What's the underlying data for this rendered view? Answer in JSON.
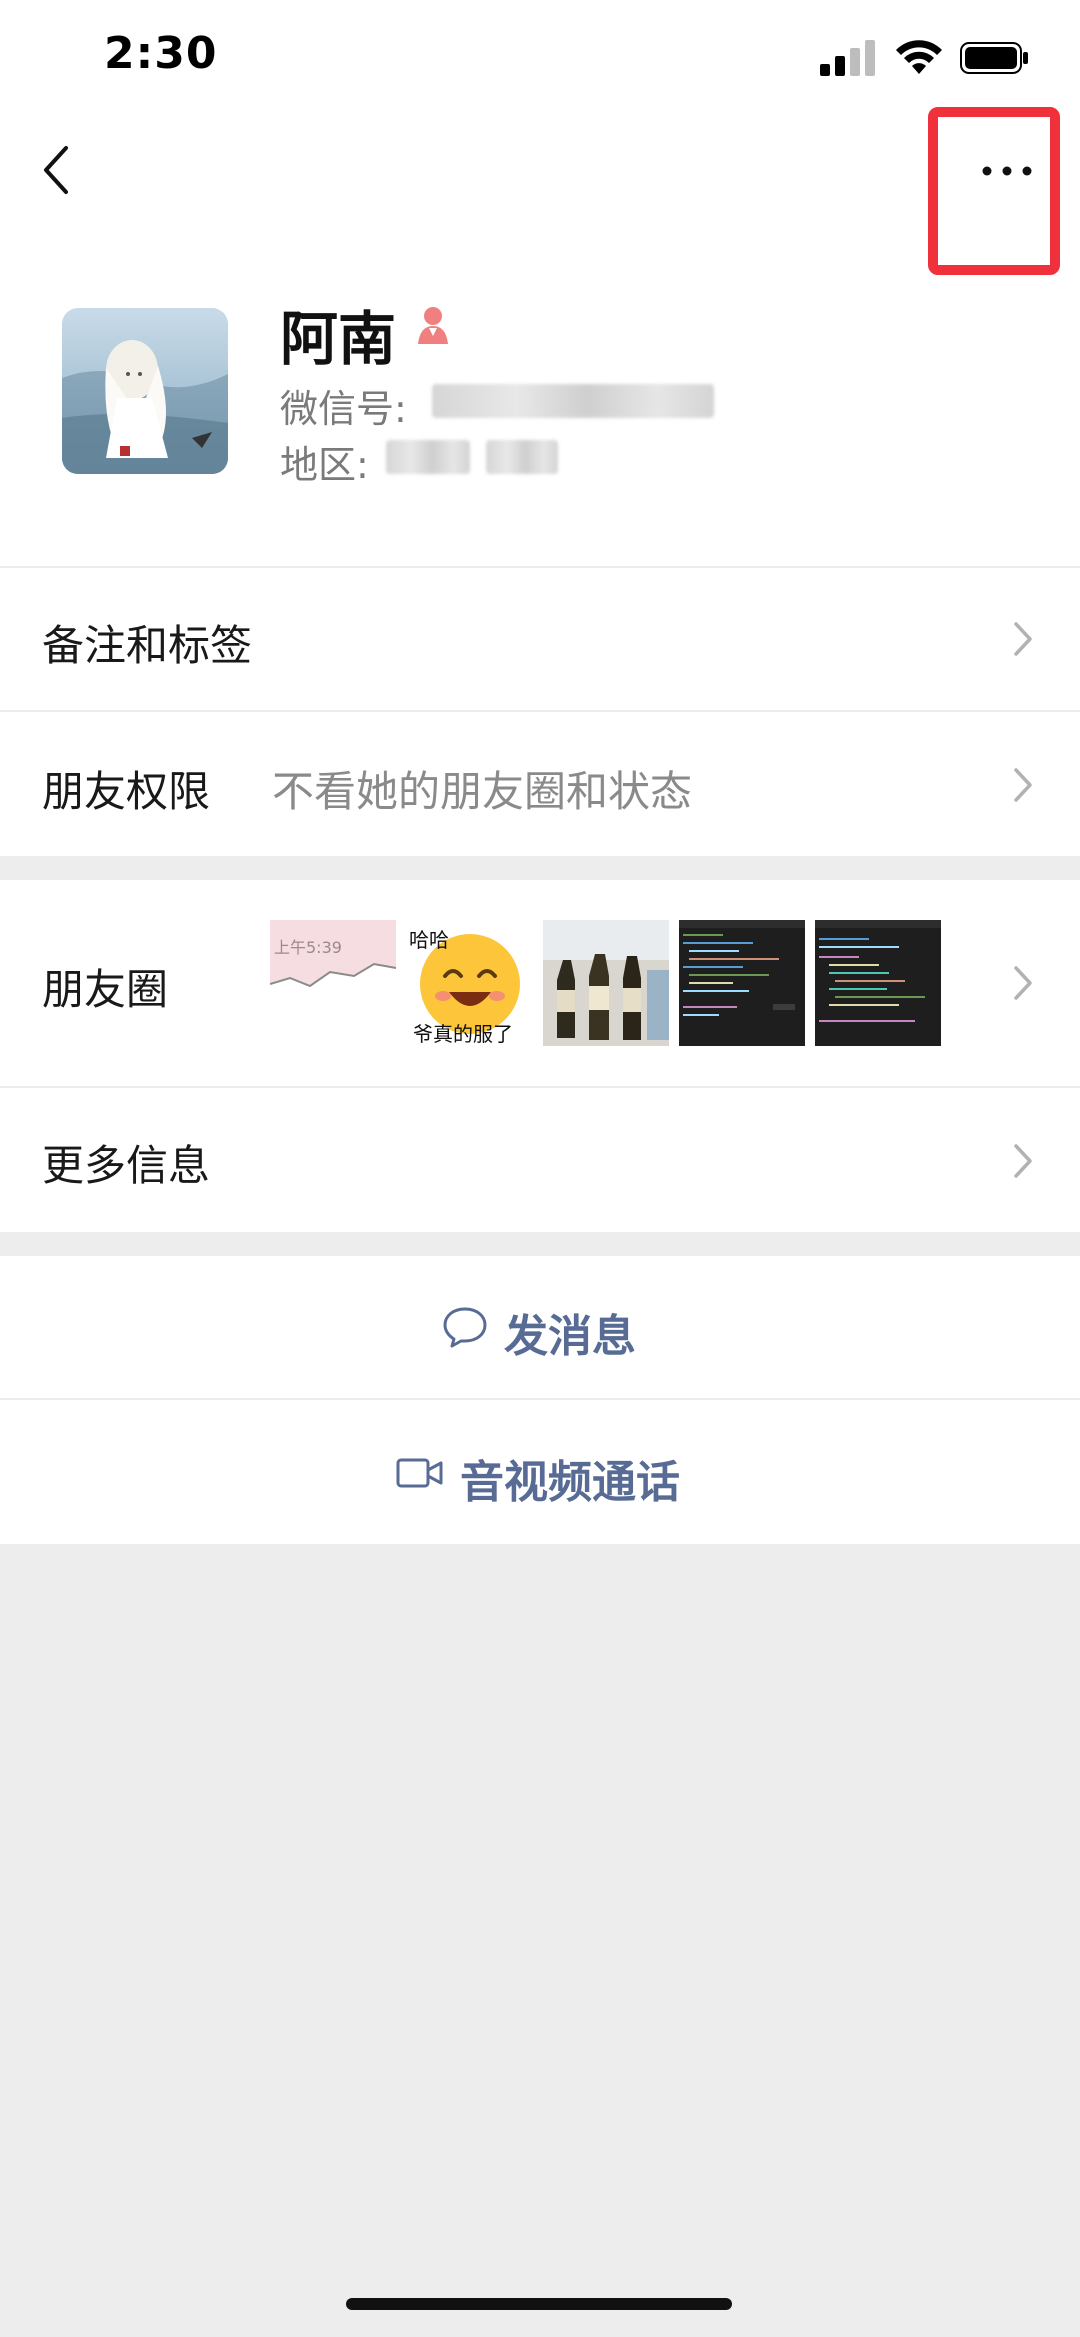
{
  "status_bar": {
    "time": "2:30",
    "icons": [
      "signal-icon",
      "wifi-icon",
      "battery-icon"
    ]
  },
  "nav": {
    "back_icon": "chevron-left-icon",
    "more_icon": "more-dots-icon",
    "highlight_color": "#f0303a"
  },
  "profile": {
    "nickname": "阿南",
    "gender_icon": "female-icon",
    "wechat_id_label": "微信号:",
    "region_label": "地区:"
  },
  "rows": {
    "remarks_tags": {
      "label": "备注和标签"
    },
    "friend_permissions": {
      "label": "朋友权限",
      "value": "不看她的朋友圈和状态"
    },
    "moments": {
      "label": "朋友圈",
      "thumbs": [
        {
          "caption": "上午5:39"
        },
        {
          "caption_top": "哈哈",
          "caption_bottom": "爷真的服了"
        },
        {},
        {},
        {}
      ]
    },
    "more_info": {
      "label": "更多信息"
    }
  },
  "actions": {
    "send_message": {
      "label": "发消息",
      "icon": "chat-bubble-icon"
    },
    "av_call": {
      "label": "音视频通话",
      "icon": "video-camera-icon"
    }
  },
  "colors": {
    "link_blue": "#576b95",
    "background": "#ededed"
  }
}
